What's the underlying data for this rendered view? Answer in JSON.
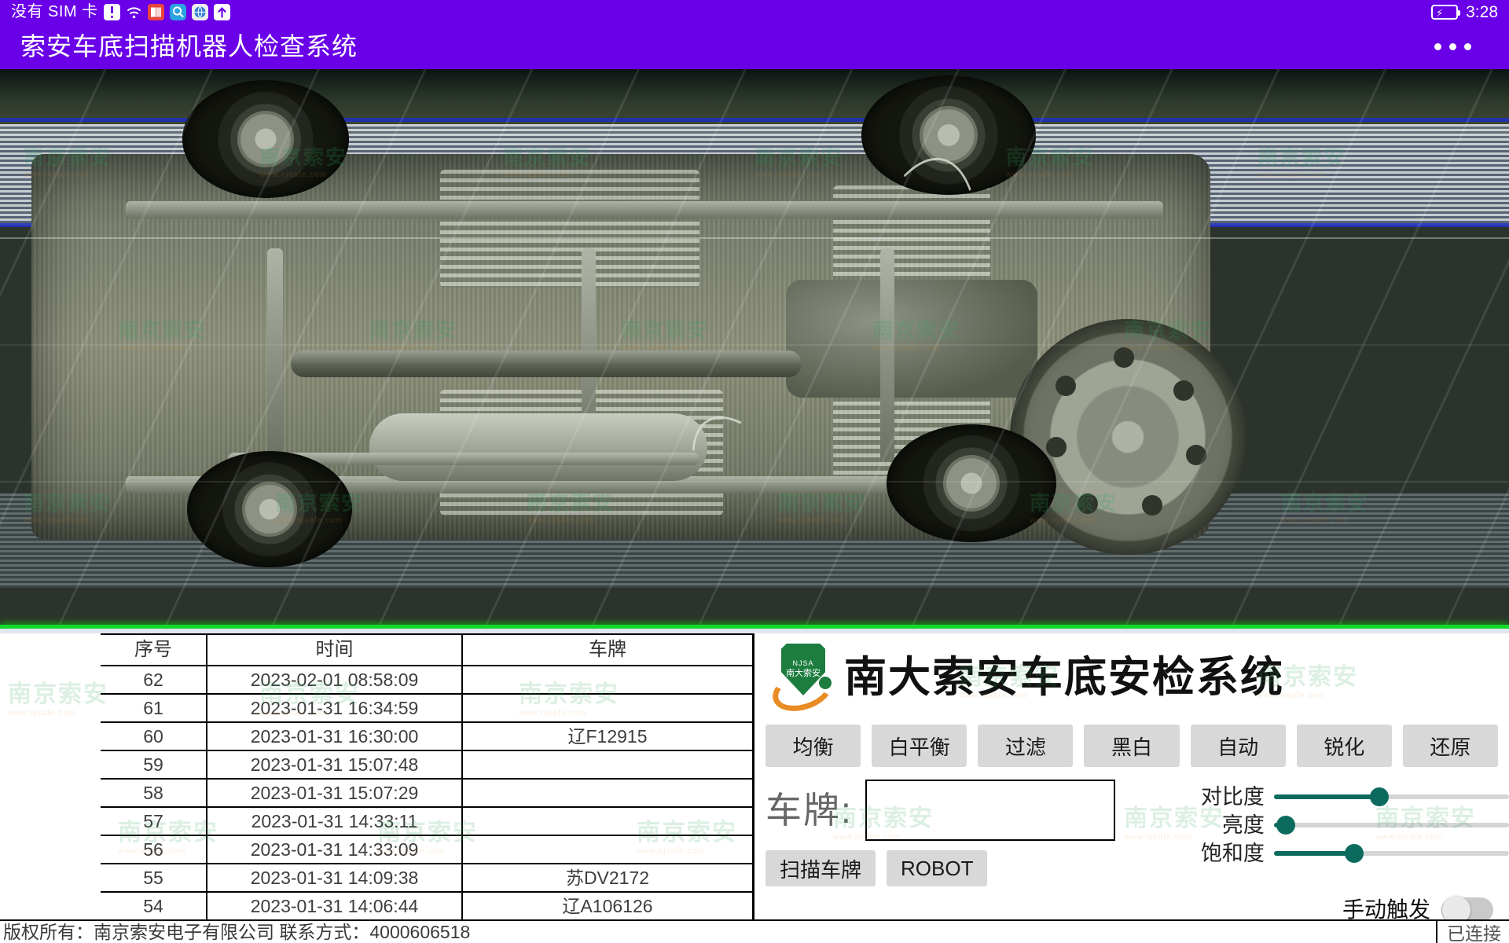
{
  "status_bar": {
    "carrier": "没有 SIM 卡",
    "clock": "3:28",
    "icons": [
      "sim-card-icon",
      "alert-icon",
      "wifi-icon",
      "book-icon",
      "search-icon",
      "browser-icon",
      "upload-icon",
      "battery-charging-icon"
    ]
  },
  "title_bar": {
    "title": "索安车底扫描机器人检查系统",
    "overflow_label": "更多"
  },
  "scan_view": {
    "watermark": "南京索安",
    "watermark_sub": "www.njsafe.com"
  },
  "records": {
    "columns": [
      "序号",
      "时间",
      "车牌"
    ],
    "rows": [
      {
        "id": "62",
        "time": "2023-02-01 08:58:09",
        "plate": ""
      },
      {
        "id": "61",
        "time": "2023-01-31 16:34:59",
        "plate": ""
      },
      {
        "id": "60",
        "time": "2023-01-31 16:30:00",
        "plate": "辽F12915"
      },
      {
        "id": "59",
        "time": "2023-01-31 15:07:48",
        "plate": ""
      },
      {
        "id": "58",
        "time": "2023-01-31 15:07:29",
        "plate": ""
      },
      {
        "id": "57",
        "time": "2023-01-31 14:33:11",
        "plate": ""
      },
      {
        "id": "56",
        "time": "2023-01-31 14:33:09",
        "plate": ""
      },
      {
        "id": "55",
        "time": "2023-01-31 14:09:38",
        "plate": "苏DV2172"
      },
      {
        "id": "54",
        "time": "2023-01-31 14:06:44",
        "plate": "辽A106126"
      }
    ]
  },
  "panel": {
    "brand_title": "南大索安车底安检系统",
    "logo": {
      "abbr": "NJSA",
      "cn": "南大索安"
    },
    "filters": [
      {
        "label": "均衡"
      },
      {
        "label": "白平衡"
      },
      {
        "label": "过滤"
      },
      {
        "label": "黑白"
      },
      {
        "label": "自动"
      },
      {
        "label": "锐化"
      },
      {
        "label": "还原"
      }
    ],
    "plate": {
      "label": "车牌:",
      "value": "",
      "placeholder": "",
      "scan_button": "扫描车牌",
      "robot_button": "ROBOT"
    },
    "sliders": [
      {
        "label": "对比度",
        "value": 45
      },
      {
        "label": "亮度",
        "value": 5
      },
      {
        "label": "饱和度",
        "value": 34
      }
    ],
    "manual_trigger": {
      "label": "手动触发",
      "on": false
    }
  },
  "footer": {
    "copyright": "版权所有：南京索安电子有限公司  联系方式：4000606518",
    "connection": "已连接"
  }
}
